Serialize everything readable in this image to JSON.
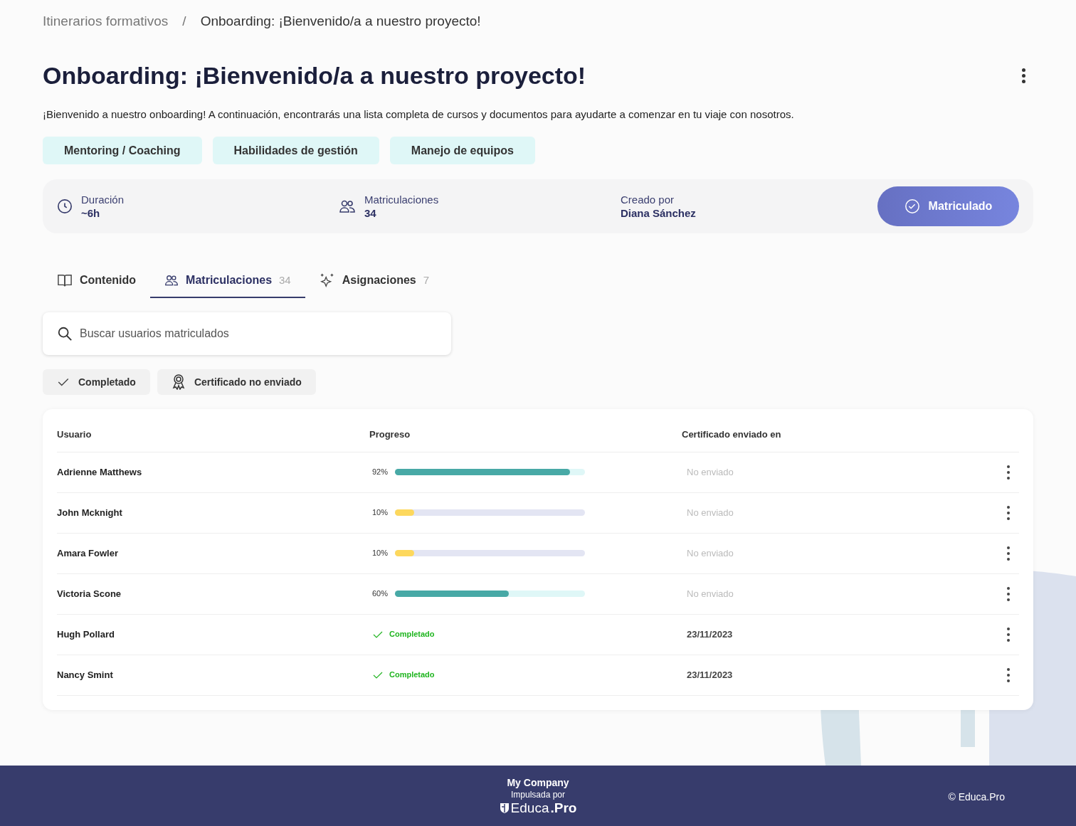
{
  "breadcrumb": [
    "Itinerarios formativos",
    "Onboarding: ¡Bienvenido/a a nuestro proyecto!"
  ],
  "breadcrumb_separator": "/",
  "title": "Onboarding: ¡Bienvenido/a a nuestro proyecto!",
  "description": "¡Bienvenido a nuestro onboarding! A continuación, encontrarás una lista completa de cursos y documentos para ayudarte a comenzar en tu viaje con nosotros.",
  "tags": [
    "Mentoring / Coaching",
    "Habilidades de gestión",
    "Manejo de equipos"
  ],
  "info": [
    {
      "kind": "duration",
      "label": "Duración",
      "value": "~6h"
    },
    {
      "kind": "enrollments",
      "label": "Matriculaciones",
      "value": "34"
    },
    {
      "kind": "author",
      "label": "Creado por",
      "value": "Diana Sánchez"
    }
  ],
  "enroll_button": {
    "label": "Matriculado",
    "enrolled": true
  },
  "tabs": [
    {
      "kind": "content",
      "label": "Contenido",
      "selected": false
    },
    {
      "kind": "enrollments",
      "label": "Matriculaciones",
      "count": "34",
      "selected": true
    },
    {
      "kind": "assignments",
      "label": "Asignaciones",
      "count": "7",
      "selected": false
    }
  ],
  "search": {
    "placeholder": "Buscar usuarios matriculados"
  },
  "filters": [
    {
      "kind": "completed",
      "label": "Completado"
    },
    {
      "kind": "certificate",
      "label": "Certificado no enviado"
    }
  ],
  "table": {
    "columns": [
      "Usuario",
      "Progreso",
      "Certificado enviado en"
    ],
    "rows": [
      {
        "user": "Adrienne Matthews",
        "kind": "progress",
        "percent": "92%",
        "level": 0.92,
        "certificate": "No enviado",
        "sent": false
      },
      {
        "user": "John Mcknight",
        "kind": "progress",
        "percent": "10%",
        "level": 0.1,
        "certificate": "No enviado",
        "sent": false
      },
      {
        "user": "Amara Fowler",
        "kind": "progress",
        "percent": "10%",
        "level": 0.1,
        "certificate": "No enviado",
        "sent": false
      },
      {
        "user": "Victoria Scone",
        "kind": "progress",
        "percent": "60%",
        "level": 0.6,
        "certificate": "No enviado",
        "sent": false
      },
      {
        "user": "Hugh Pollard",
        "kind": "completed",
        "status": "Completado",
        "certificate": "23/11/2023",
        "sent": true
      },
      {
        "user": "Nancy Smint",
        "kind": "completed",
        "status": "Completado",
        "certificate": "23/11/2023",
        "sent": true
      }
    ]
  },
  "footer": {
    "company": "My Company",
    "powered_by": "Impulsada por",
    "logo": [
      "Educa",
      ".Pro"
    ],
    "copyright": "© Educa.Pro"
  }
}
